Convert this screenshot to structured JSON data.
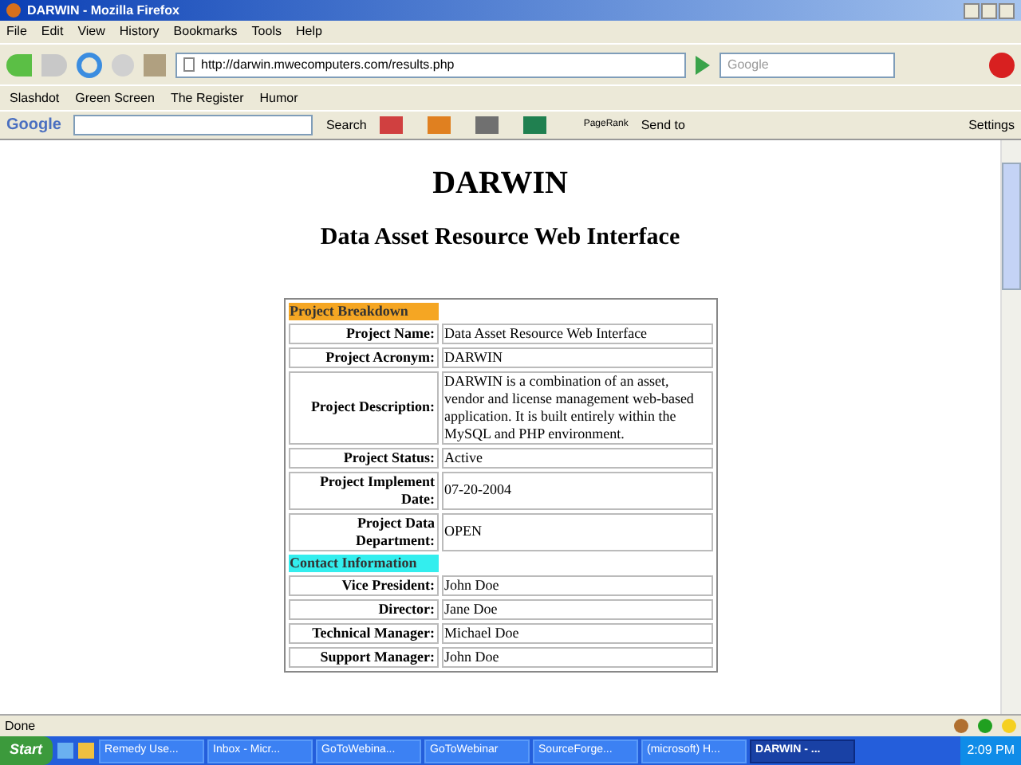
{
  "window": {
    "title": "DARWIN - Mozilla Firefox"
  },
  "menu": [
    "File",
    "Edit",
    "View",
    "History",
    "Bookmarks",
    "Tools",
    "Help"
  ],
  "address": {
    "url": "http://darwin.mwecomputers.com/results.php"
  },
  "search": {
    "placeholder": "Google"
  },
  "bookmarks": [
    "Slashdot",
    "Green Screen",
    "The Register",
    "Humor"
  ],
  "google_toolbar": {
    "logo": "Google",
    "search": "Search",
    "pagerank": "PageRank",
    "send_to": "Send to",
    "settings": "Settings"
  },
  "page": {
    "heading": "DARWIN",
    "subheading": "Data Asset Resource Web Interface",
    "sections": [
      {
        "title": "Project Breakdown",
        "color": "#f5a623",
        "rows": [
          {
            "label": "Project Name:",
            "value": "Data Asset Resource Web Interface"
          },
          {
            "label": "Project Acronym:",
            "value": "DARWIN"
          },
          {
            "label": "Project Description:",
            "value": "DARWIN is a combination of an asset, vendor and license management web-based application. It is built entirely within the MySQL and PHP environment."
          },
          {
            "label": "Project Status:",
            "value": "Active"
          },
          {
            "label": "Project Implement Date:",
            "value": "07-20-2004"
          },
          {
            "label": "Project Data Department:",
            "value": "OPEN"
          }
        ]
      },
      {
        "title": "Contact Information",
        "color": "#33eeee",
        "rows": [
          {
            "label": "Vice President:",
            "value": "John Doe"
          },
          {
            "label": "Director:",
            "value": "Jane Doe"
          },
          {
            "label": "Technical Manager:",
            "value": "Michael Doe"
          },
          {
            "label": "Support Manager:",
            "value": "John Doe"
          }
        ]
      }
    ]
  },
  "status_bar": {
    "text": "Done"
  },
  "taskbar": {
    "start": "Start",
    "tasks": [
      {
        "label": "Remedy Use...",
        "selected": false
      },
      {
        "label": "Inbox - Micr...",
        "selected": false
      },
      {
        "label": "GoToWebina...",
        "selected": false
      },
      {
        "label": "GoToWebinar",
        "selected": false
      },
      {
        "label": "SourceForge...",
        "selected": false
      },
      {
        "label": "(microsoft) H...",
        "selected": false
      },
      {
        "label": "DARWIN - ...",
        "selected": true
      }
    ],
    "clock": "2:09 PM"
  }
}
